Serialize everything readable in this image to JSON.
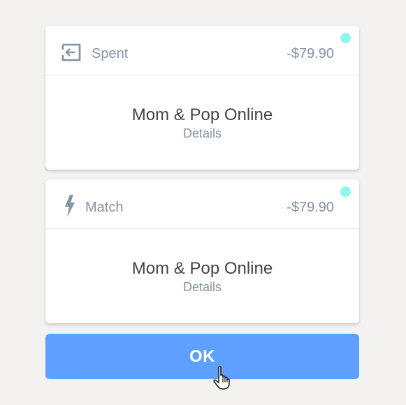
{
  "colors": {
    "background": "#f3f2f1",
    "card": "#ffffff",
    "status_dot": "#8ef6ee",
    "muted_text": "#8592a3",
    "primary_text": "#444444",
    "button": "#5ea0ff",
    "button_text": "#ffffff"
  },
  "transactions": [
    {
      "icon": "sign-out-icon",
      "label": "Spent",
      "amount": "-$79.90",
      "merchant": "Mom & Pop Online",
      "details_label": "Details"
    },
    {
      "icon": "lightning-bolt-icon",
      "label": "Match",
      "amount": "-$79.90",
      "merchant": "Mom & Pop Online",
      "details_label": "Details"
    }
  ],
  "ok_button": {
    "label": "OK"
  },
  "cursor": {
    "icon": "hand-pointer-cursor-icon"
  }
}
